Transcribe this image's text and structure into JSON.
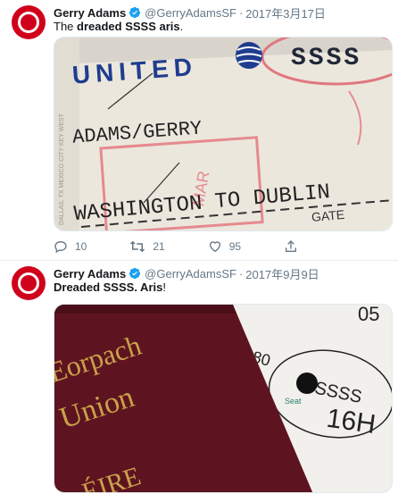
{
  "tweets": [
    {
      "name": "Gerry Adams",
      "handle": "@GerryAdamsSF",
      "separator": "·",
      "date": "2017年3月17日",
      "text_parts": [
        "The ",
        "dreaded SSSS aris",
        "."
      ],
      "image": {
        "airline": "UNITED",
        "code": "SSSS",
        "passenger": "ADAMS/GERRY",
        "route": "WASHINGTON TO DUBLIN",
        "gate": "GATE",
        "stamp": "MAR",
        "side_text": "DALLAS, TX   MEXICO CITY   KEY WEST"
      },
      "actions": {
        "replies": "10",
        "retweets": "21",
        "likes": "95"
      }
    },
    {
      "name": "Gerry Adams",
      "handle": "@GerryAdamsSF",
      "separator": "·",
      "date": "2017年9月9日",
      "text_parts": [
        "Dreaded SSSS. Aris",
        "!"
      ],
      "image": {
        "passport_line1": "Eorpach",
        "passport_line2": "Union",
        "passport_bottom": "ÉIRE",
        "code": "SSSS",
        "seat_label": "Seat",
        "seat": "16H",
        "top_fragment": "05",
        "side_fragment": "80"
      }
    }
  ]
}
